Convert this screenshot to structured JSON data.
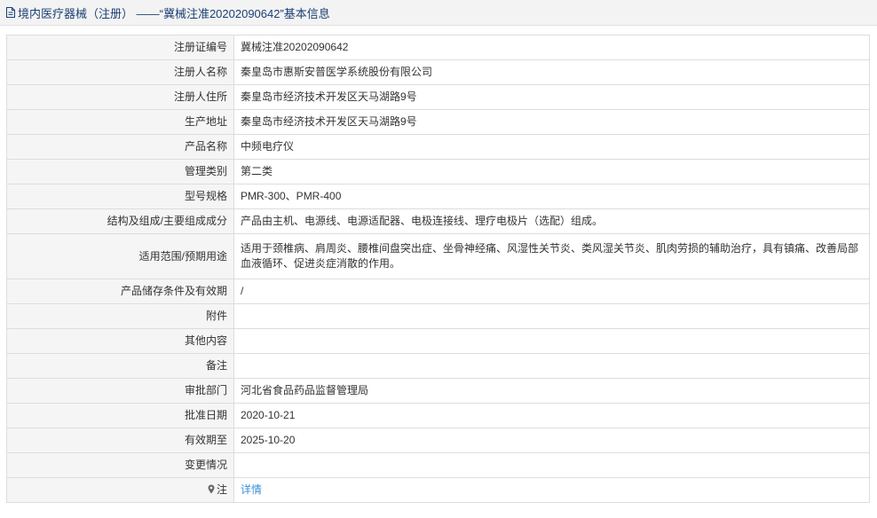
{
  "header": {
    "title": "境内医疗器械（注册） ——“冀械注准20202090642”基本信息",
    "icon": "document-icon"
  },
  "colors": {
    "title": "#1a3f73",
    "label_bg": "#f5f5f5",
    "border": "#dddddd",
    "link": "#3b8fd6"
  },
  "rows": [
    {
      "label": "注册证编号",
      "value": "冀械注准20202090642"
    },
    {
      "label": "注册人名称",
      "value": "秦皇岛市惠斯安普医学系统股份有限公司"
    },
    {
      "label": "注册人住所",
      "value": "秦皇岛市经济技术开发区天马湖路9号"
    },
    {
      "label": "生产地址",
      "value": "秦皇岛市经济技术开发区天马湖路9号"
    },
    {
      "label": "产品名称",
      "value": "中频电疗仪"
    },
    {
      "label": "管理类别",
      "value": "第二类"
    },
    {
      "label": "型号规格",
      "value": "PMR-300、PMR-400"
    },
    {
      "label": "结构及组成/主要组成成分",
      "value": "产品由主机、电源线、电源适配器、电极连接线、理疗电极片（选配）组成。"
    },
    {
      "label": "适用范围/预期用途",
      "value": "适用于颈椎病、肩周炎、腰椎间盘突出症、坐骨神经痛、风湿性关节炎、类风湿关节炎、肌肉劳损的辅助治疗，具有镇痛、改善局部血液循环、促进炎症消散的作用。"
    },
    {
      "label": "产品储存条件及有效期",
      "value": "/"
    },
    {
      "label": "附件",
      "value": ""
    },
    {
      "label": "其他内容",
      "value": ""
    },
    {
      "label": "备注",
      "value": ""
    },
    {
      "label": "审批部门",
      "value": "河北省食品药品监督管理局"
    },
    {
      "label": "批准日期",
      "value": "2020-10-21"
    },
    {
      "label": "有效期至",
      "value": "2025-10-20"
    },
    {
      "label": "变更情况",
      "value": ""
    }
  ],
  "note": {
    "label": "注",
    "icon": "pin-icon",
    "link_text": "详情"
  }
}
